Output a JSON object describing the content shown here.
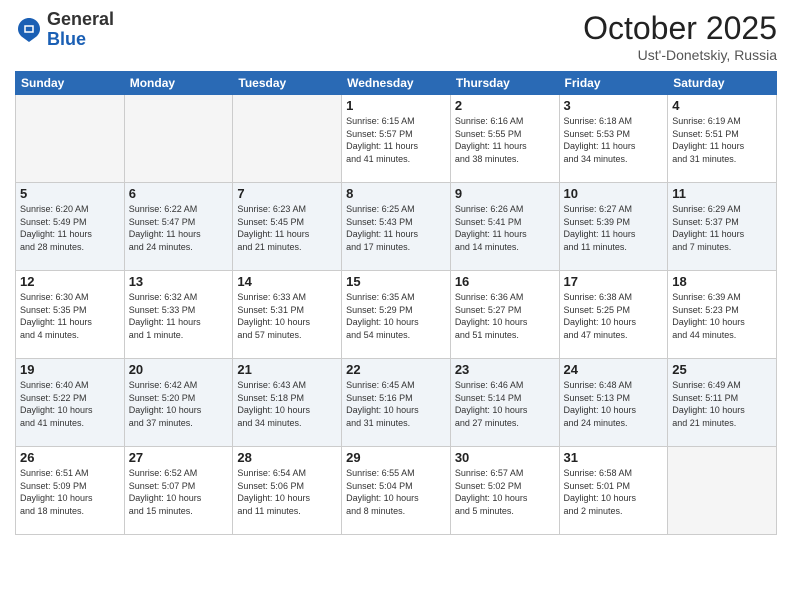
{
  "header": {
    "logo_general": "General",
    "logo_blue": "Blue",
    "month_title": "October 2025",
    "location": "Ust'-Donetskiy, Russia"
  },
  "weekdays": [
    "Sunday",
    "Monday",
    "Tuesday",
    "Wednesday",
    "Thursday",
    "Friday",
    "Saturday"
  ],
  "weeks": [
    [
      {
        "day": "",
        "info": ""
      },
      {
        "day": "",
        "info": ""
      },
      {
        "day": "",
        "info": ""
      },
      {
        "day": "1",
        "info": "Sunrise: 6:15 AM\nSunset: 5:57 PM\nDaylight: 11 hours\nand 41 minutes."
      },
      {
        "day": "2",
        "info": "Sunrise: 6:16 AM\nSunset: 5:55 PM\nDaylight: 11 hours\nand 38 minutes."
      },
      {
        "day": "3",
        "info": "Sunrise: 6:18 AM\nSunset: 5:53 PM\nDaylight: 11 hours\nand 34 minutes."
      },
      {
        "day": "4",
        "info": "Sunrise: 6:19 AM\nSunset: 5:51 PM\nDaylight: 11 hours\nand 31 minutes."
      }
    ],
    [
      {
        "day": "5",
        "info": "Sunrise: 6:20 AM\nSunset: 5:49 PM\nDaylight: 11 hours\nand 28 minutes."
      },
      {
        "day": "6",
        "info": "Sunrise: 6:22 AM\nSunset: 5:47 PM\nDaylight: 11 hours\nand 24 minutes."
      },
      {
        "day": "7",
        "info": "Sunrise: 6:23 AM\nSunset: 5:45 PM\nDaylight: 11 hours\nand 21 minutes."
      },
      {
        "day": "8",
        "info": "Sunrise: 6:25 AM\nSunset: 5:43 PM\nDaylight: 11 hours\nand 17 minutes."
      },
      {
        "day": "9",
        "info": "Sunrise: 6:26 AM\nSunset: 5:41 PM\nDaylight: 11 hours\nand 14 minutes."
      },
      {
        "day": "10",
        "info": "Sunrise: 6:27 AM\nSunset: 5:39 PM\nDaylight: 11 hours\nand 11 minutes."
      },
      {
        "day": "11",
        "info": "Sunrise: 6:29 AM\nSunset: 5:37 PM\nDaylight: 11 hours\nand 7 minutes."
      }
    ],
    [
      {
        "day": "12",
        "info": "Sunrise: 6:30 AM\nSunset: 5:35 PM\nDaylight: 11 hours\nand 4 minutes."
      },
      {
        "day": "13",
        "info": "Sunrise: 6:32 AM\nSunset: 5:33 PM\nDaylight: 11 hours\nand 1 minute."
      },
      {
        "day": "14",
        "info": "Sunrise: 6:33 AM\nSunset: 5:31 PM\nDaylight: 10 hours\nand 57 minutes."
      },
      {
        "day": "15",
        "info": "Sunrise: 6:35 AM\nSunset: 5:29 PM\nDaylight: 10 hours\nand 54 minutes."
      },
      {
        "day": "16",
        "info": "Sunrise: 6:36 AM\nSunset: 5:27 PM\nDaylight: 10 hours\nand 51 minutes."
      },
      {
        "day": "17",
        "info": "Sunrise: 6:38 AM\nSunset: 5:25 PM\nDaylight: 10 hours\nand 47 minutes."
      },
      {
        "day": "18",
        "info": "Sunrise: 6:39 AM\nSunset: 5:23 PM\nDaylight: 10 hours\nand 44 minutes."
      }
    ],
    [
      {
        "day": "19",
        "info": "Sunrise: 6:40 AM\nSunset: 5:22 PM\nDaylight: 10 hours\nand 41 minutes."
      },
      {
        "day": "20",
        "info": "Sunrise: 6:42 AM\nSunset: 5:20 PM\nDaylight: 10 hours\nand 37 minutes."
      },
      {
        "day": "21",
        "info": "Sunrise: 6:43 AM\nSunset: 5:18 PM\nDaylight: 10 hours\nand 34 minutes."
      },
      {
        "day": "22",
        "info": "Sunrise: 6:45 AM\nSunset: 5:16 PM\nDaylight: 10 hours\nand 31 minutes."
      },
      {
        "day": "23",
        "info": "Sunrise: 6:46 AM\nSunset: 5:14 PM\nDaylight: 10 hours\nand 27 minutes."
      },
      {
        "day": "24",
        "info": "Sunrise: 6:48 AM\nSunset: 5:13 PM\nDaylight: 10 hours\nand 24 minutes."
      },
      {
        "day": "25",
        "info": "Sunrise: 6:49 AM\nSunset: 5:11 PM\nDaylight: 10 hours\nand 21 minutes."
      }
    ],
    [
      {
        "day": "26",
        "info": "Sunrise: 6:51 AM\nSunset: 5:09 PM\nDaylight: 10 hours\nand 18 minutes."
      },
      {
        "day": "27",
        "info": "Sunrise: 6:52 AM\nSunset: 5:07 PM\nDaylight: 10 hours\nand 15 minutes."
      },
      {
        "day": "28",
        "info": "Sunrise: 6:54 AM\nSunset: 5:06 PM\nDaylight: 10 hours\nand 11 minutes."
      },
      {
        "day": "29",
        "info": "Sunrise: 6:55 AM\nSunset: 5:04 PM\nDaylight: 10 hours\nand 8 minutes."
      },
      {
        "day": "30",
        "info": "Sunrise: 6:57 AM\nSunset: 5:02 PM\nDaylight: 10 hours\nand 5 minutes."
      },
      {
        "day": "31",
        "info": "Sunrise: 6:58 AM\nSunset: 5:01 PM\nDaylight: 10 hours\nand 2 minutes."
      },
      {
        "day": "",
        "info": ""
      }
    ]
  ]
}
